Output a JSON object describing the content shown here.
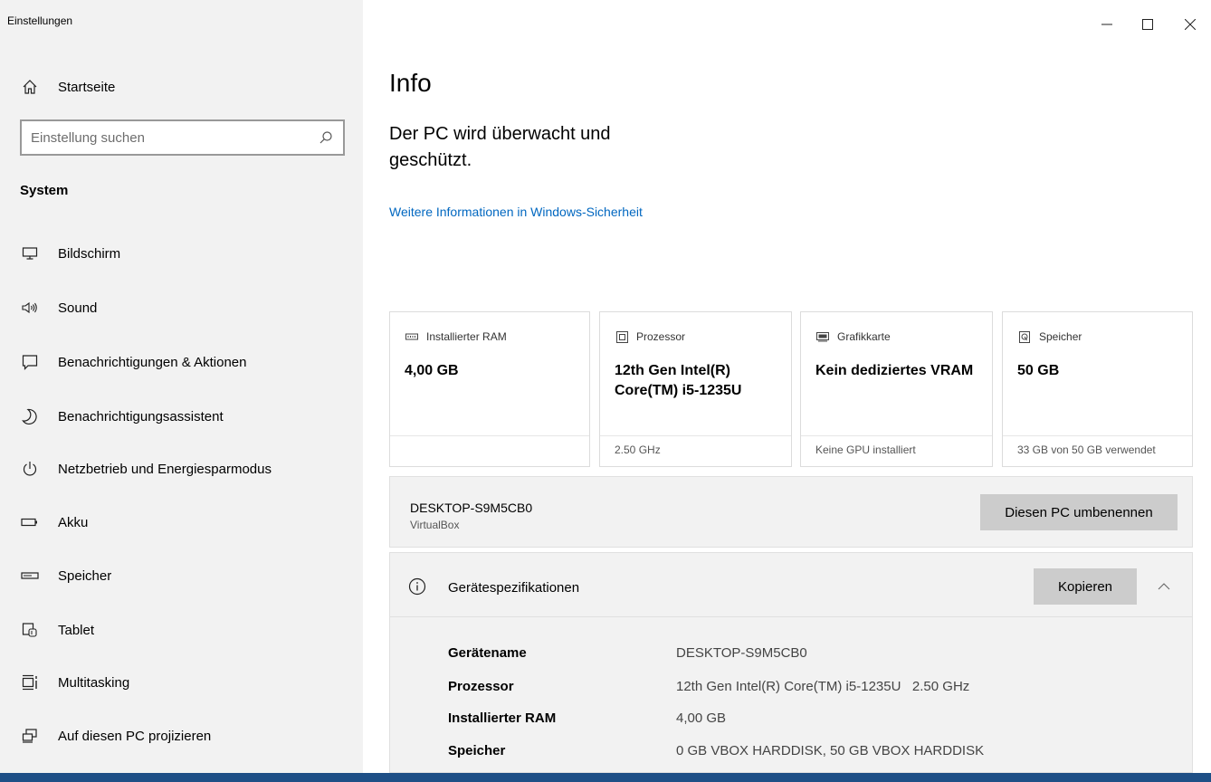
{
  "window": {
    "title": "Einstellungen",
    "controls": {
      "minimize": "–",
      "maximize": "☐",
      "close": "✕"
    }
  },
  "sidebar": {
    "home_label": "Startseite",
    "search_placeholder": "Einstellung suchen",
    "section": "System",
    "items": [
      {
        "label": "Bildschirm",
        "icon": "monitor-icon"
      },
      {
        "label": "Sound",
        "icon": "speaker-icon"
      },
      {
        "label": "Benachrichtigungen & Aktionen",
        "icon": "notification-icon"
      },
      {
        "label": "Benachrichtigungsassistent",
        "icon": "moon-icon"
      },
      {
        "label": "Netzbetrieb und Energiesparmodus",
        "icon": "power-icon"
      },
      {
        "label": "Akku",
        "icon": "battery-icon"
      },
      {
        "label": "Speicher",
        "icon": "storage-icon"
      },
      {
        "label": "Tablet",
        "icon": "tablet-icon"
      },
      {
        "label": "Multitasking",
        "icon": "multitasking-icon"
      },
      {
        "label": "Auf diesen PC projizieren",
        "icon": "project-icon"
      }
    ]
  },
  "main": {
    "title": "Info",
    "protection_text": "Der PC wird überwacht und geschützt.",
    "security_link": "Weitere Informationen in Windows-Sicherheit",
    "cards": [
      {
        "label": "Installierter RAM",
        "value": "4,00 GB",
        "footer": "",
        "icon": "ram-icon"
      },
      {
        "label": "Prozessor",
        "value": "12th Gen Intel(R) Core(TM) i5-1235U",
        "footer": "2.50 GHz",
        "icon": "processor-icon"
      },
      {
        "label": "Grafikkarte",
        "value": "Kein dediziertes VRAM",
        "footer": "Keine GPU installiert",
        "icon": "graphics-card-icon"
      },
      {
        "label": "Speicher",
        "value": "50 GB",
        "footer": "33 GB von 50 GB verwendet",
        "icon": "storage-icon"
      }
    ],
    "pc": {
      "name": "DESKTOP-S9M5CB0",
      "model": "VirtualBox",
      "rename_button": "Diesen PC umbenennen"
    },
    "specs": {
      "title": "Gerätespezifikationen",
      "copy_button": "Kopieren",
      "rows": [
        {
          "key": "Gerätename",
          "value": "DESKTOP-S9M5CB0"
        },
        {
          "key": "Prozessor",
          "value": "12th Gen Intel(R) Core(TM) i5-1235U   2.50 GHz"
        },
        {
          "key": "Installierter RAM",
          "value": "4,00 GB"
        },
        {
          "key": "Speicher",
          "value": "0 GB VBOX HARDDISK, 50 GB VBOX HARDDISK"
        }
      ]
    }
  },
  "colors": {
    "sidebar_bg": "#f2f2f2",
    "link": "#0067c0",
    "button_bg": "#cccccc",
    "taskbar": "#1e4f86"
  }
}
